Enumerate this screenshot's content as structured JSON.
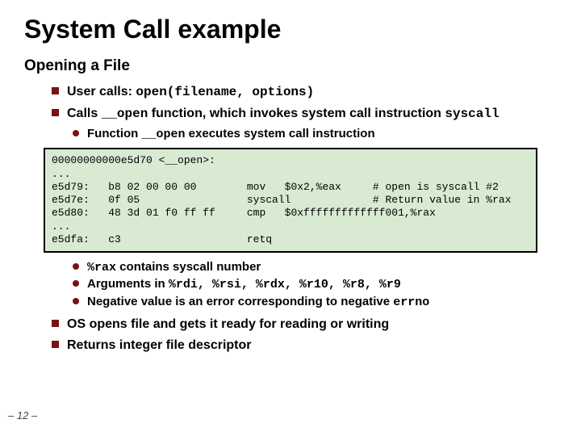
{
  "title": "System Call example",
  "subtitle": "Opening a File",
  "bullets": {
    "b1_pre": "User calls: ",
    "b1_code": "open(filename, options)",
    "b2_pre": "Calls ",
    "b2_code": "__open",
    "b2_mid": " function, which invokes system call instruction ",
    "b2_code2": "syscall",
    "b3_pre": "Function ",
    "b3_code": "__open",
    "b3_post": " executes system call instruction",
    "s1_code": "%rax",
    "s1_post": " contains syscall number",
    "s2_pre": "Arguments in ",
    "s2_code": "%rdi, %rsi, %rdx, %r10, %r8, %r9",
    "s3_pre": "Negative value is an error corresponding to negative ",
    "s3_code": "errno",
    "b4": "OS opens file and gets it ready for reading or writing",
    "b5": "Returns integer file descriptor"
  },
  "code_block": "00000000000e5d70 <__open>:\n...\ne5d79:   b8 02 00 00 00        mov   $0x2,%eax     # open is syscall #2\ne5d7e:   0f 05                 syscall             # Return value in %rax\ne5d80:   48 3d 01 f0 ff ff     cmp   $0xfffffffffffff001,%rax\n...\ne5dfa:   c3                    retq",
  "page_number": "– 12 –"
}
